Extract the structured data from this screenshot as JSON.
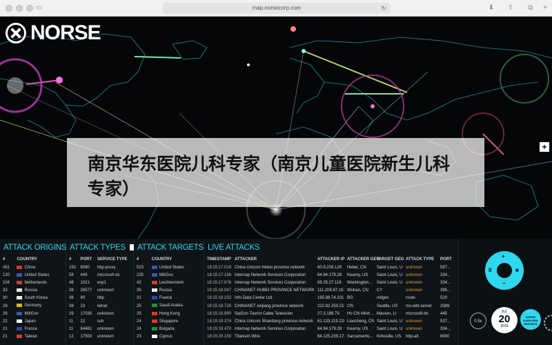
{
  "browser": {
    "url": "map.norsecorp.com"
  },
  "logo": {
    "text": "NORSE"
  },
  "map": {
    "zoom_in_label": "+"
  },
  "caption": {
    "text": "南京华东医院儿科专家（南京儿童医院新生儿科专家）"
  },
  "panels": {
    "origins": {
      "title": "Attack Origins",
      "headers": [
        "#",
        "COUNTRY"
      ],
      "rows": [
        {
          "num": "451",
          "country": "China",
          "flag": "#d63a2c"
        },
        {
          "num": "120",
          "country": "United States",
          "flag": "#3a5aa8"
        },
        {
          "num": "104",
          "country": "Netherlands",
          "flag": "#c9403a"
        },
        {
          "num": "33",
          "country": "Russia",
          "flag": "#e8e8e8"
        },
        {
          "num": "30",
          "country": "South Korea",
          "flag": "#f2f2f2"
        },
        {
          "num": "28",
          "country": "Germany",
          "flag": "#e0b020"
        },
        {
          "num": "26",
          "country": "Mil/Gov",
          "flag": "#3a5aa8"
        },
        {
          "num": "22",
          "country": "Japan",
          "flag": "#f2f2f2"
        },
        {
          "num": "21",
          "country": "France",
          "flag": "#2a4aa8"
        },
        {
          "num": "21",
          "country": "Taiwan",
          "flag": "#c9403a"
        }
      ]
    },
    "types": {
      "title": "Attack Types",
      "headers": [
        "#",
        "PORT",
        "SERVICE TYPE"
      ],
      "rows": [
        {
          "num": "152",
          "port": "8080",
          "service": "http-proxy"
        },
        {
          "num": "58",
          "port": "445",
          "service": "microsoft-ds"
        },
        {
          "num": "48",
          "port": "1021",
          "service": "exp1"
        },
        {
          "num": "38",
          "port": "26577",
          "service": "unknown"
        },
        {
          "num": "38",
          "port": "80",
          "service": "http"
        },
        {
          "num": "38",
          "port": "23",
          "service": "telnet"
        },
        {
          "num": "29",
          "port": "17035",
          "service": "unknown"
        },
        {
          "num": "11",
          "port": "22",
          "service": "ssh"
        },
        {
          "num": "11",
          "port": "64461",
          "service": "unknown"
        },
        {
          "num": "12",
          "port": "17500",
          "service": "unknown"
        }
      ]
    },
    "targets": {
      "title": "Attack Targets",
      "headers": [
        "#",
        "COUNTRY"
      ],
      "rows": [
        {
          "num": "523",
          "country": "United States",
          "flag": "#3a5aa8"
        },
        {
          "num": "235",
          "country": "Mil/Gov",
          "flag": "#3a5aa8"
        },
        {
          "num": "42",
          "country": "Liechtenstein",
          "flag": "#c9403a"
        },
        {
          "num": "35",
          "country": "Russia",
          "flag": "#e8e8e8"
        },
        {
          "num": "31",
          "country": "France",
          "flag": "#2a4aa8"
        },
        {
          "num": "25",
          "country": "Saudi Arabia",
          "flag": "#2f8a3a"
        },
        {
          "num": "25",
          "country": "Hong Kong",
          "flag": "#d63a2c"
        },
        {
          "num": "24",
          "country": "Singapore",
          "flag": "#d63a2c"
        },
        {
          "num": "24",
          "country": "Bulgaria",
          "flag": "#2f8a3a"
        },
        {
          "num": "23",
          "country": "Cyprus",
          "flag": "#f2f2f2"
        }
      ]
    },
    "live": {
      "title": "Live Attacks",
      "headers": [
        "TIMESTAMP",
        "ATTACKER",
        "ATTACKER IP",
        "ATTACKER GEO",
        "TARGET GEO",
        "ATTACK TYPE",
        "PORT"
      ],
      "rows": [
        {
          "ts": "18:15:17.019",
          "attacker": "China Unicom Hebei province network",
          "ip": "60.9.208.129",
          "ageo": "Hebei, CN",
          "tgeo": "Saint Louis, US",
          "type": "unknown",
          "port": "587..."
        },
        {
          "ts": "18:15:17.196",
          "attacker": "Internap Network Services Corporation",
          "ip": "64.94.179.28",
          "ageo": "Kearny, US",
          "tgeo": "Saint Louis, US",
          "type": "unknown",
          "port": "334..."
        },
        {
          "ts": "18:15:17.676",
          "attacker": "Internap Network Services Corporation",
          "ip": "69.25.27.118",
          "ageo": "Washington...",
          "tgeo": "Saint Louis, US",
          "type": "unknown",
          "port": "334..."
        },
        {
          "ts": "18:15:18.047",
          "attacker": "CHINANET HUBEI PROVINCE NETWORK",
          "ip": "111.209.87.161",
          "ageo": "Wuhan, CN",
          "tgeo": "CY",
          "type": "unknown",
          "port": "395..."
        },
        {
          "ts": "18:15:18.232",
          "attacker": "Info Data Center Ltd.",
          "ip": "195.88.74.101",
          "ageo": "BG",
          "tgeo": "milgov",
          "type": "route",
          "port": "520"
        },
        {
          "ts": "18:15:18.726",
          "attacker": "CHINANET xinjiang province network",
          "ip": "222.82.250.210",
          "ageo": "CN",
          "tgeo": "Seattle, US",
          "type": "ms-wbt-server",
          "port": "3389"
        },
        {
          "ts": "18:15:18.890",
          "attacker": "SaiGon Tourist Cable Television",
          "ip": "27.3.188.79",
          "ageo": "Ho Chi Minh ...",
          "tgeo": "Mauren, LI",
          "type": "microsoft-ds",
          "port": "445"
        },
        {
          "ts": "18:15:19.274",
          "attacker": "China Unicom Shandong province network",
          "ip": "61.133.119.229",
          "ageo": "Liaocheng, CN",
          "tgeo": "Saint Louis, US",
          "type": "unknown",
          "port": "537..."
        },
        {
          "ts": "18:15:19.470",
          "attacker": "Internap Network Services Corporation",
          "ip": "64.94.179.28",
          "ageo": "Kearny, US",
          "tgeo": "Saint Louis, US",
          "type": "unknown",
          "port": "334..."
        },
        {
          "ts": "18:15:20.150",
          "attacker": "Titanium Wire",
          "ip": "64.125.239.178",
          "ageo": "Sacramento...",
          "tgeo": "Kirksville, US",
          "type": "http-alt",
          "port": "8000"
        }
      ]
    }
  },
  "controls": {
    "up": "+",
    "down": "−",
    "pause": "II",
    "stop": "■",
    "speed": "0.5x",
    "date_month": "JUL",
    "date_day": "20",
    "date_year": "2015",
    "badge": "NORSE DARKVIEW REPORTS"
  }
}
